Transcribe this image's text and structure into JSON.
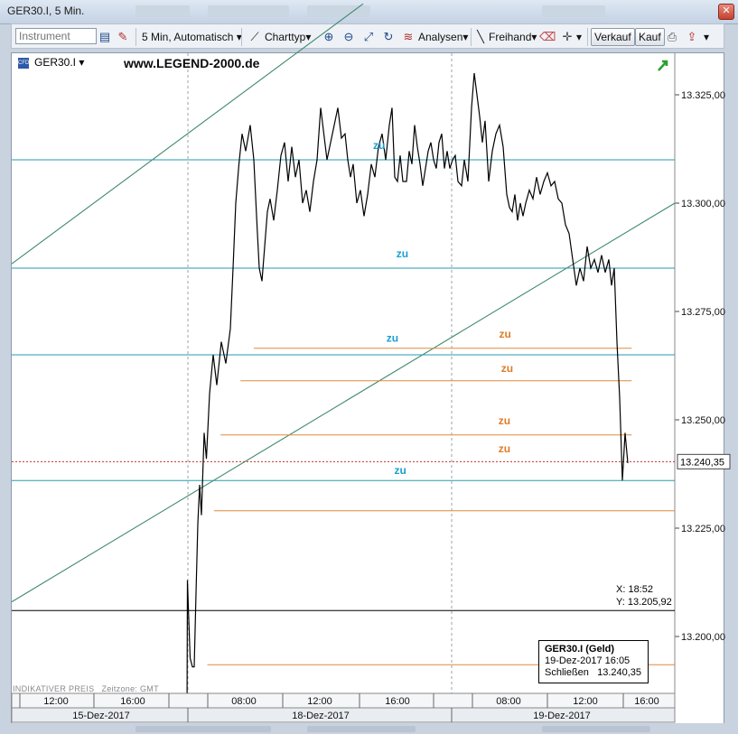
{
  "window": {
    "title": "GER30.I, 5 Min."
  },
  "toolbar": {
    "instrument_placeholder": "Instrument",
    "interval_label": "5 Min,  Automatisch",
    "charttype_label": "Charttyp",
    "analysen_label": "Analysen",
    "freihand_label": "Freihand",
    "verkauf_label": "Verkauf",
    "kauf_label": "Kauf"
  },
  "legend": {
    "symbol": "GER30.I",
    "cfd_badge": "CFD",
    "website": "www.LEGEND-2000.de"
  },
  "crosshair": {
    "x_label": "X: 18:52",
    "y_label": "Y: 13.205,92",
    "y_value": 13205.92
  },
  "infobox": {
    "title": "GER30.I (Geld)",
    "datetime": "19-Dez-2017 16:05",
    "close_label": "Schließen",
    "close_value": "13.240,35"
  },
  "footer": {
    "indicative": "INDIKATIVER PREIS",
    "timezone": "Zeitzone: GMT"
  },
  "colors": {
    "price": "#000000",
    "cyan": "#2a9ab0",
    "orange": "#e08a3a",
    "channel": "#3f8a6a",
    "price_dotted": "#c03030",
    "label_cyan": "#1a9fd0",
    "label_orange": "#e07b28",
    "arrow": "#2aa02a"
  },
  "chart_data": {
    "type": "line",
    "instrument": "GER30.I",
    "interval": "5 Min",
    "y_range": [
      13180,
      13340
    ],
    "y_ticks": [
      {
        "value": 13200,
        "label": "13.200,00"
      },
      {
        "value": 13225,
        "label": "13.225,00"
      },
      {
        "value": 13250,
        "label": "13.250,00"
      },
      {
        "value": 13275,
        "label": "13.275,00"
      },
      {
        "value": 13300,
        "label": "13.300,00"
      },
      {
        "value": 13325,
        "label": "13.325,00"
      }
    ],
    "current_price": {
      "value": 13240.35,
      "label": "13.240,35"
    },
    "x_time_labels": [
      "12:00",
      "16:00",
      "08:00",
      "12:00",
      "16:00",
      "08:00",
      "12:00",
      "16:00"
    ],
    "x_date_labels": [
      "15-Dez-2017",
      "18-Dez-2017",
      "19-Dez-2017"
    ],
    "price_series": [
      {
        "t": 0.0,
        "v": 13181
      },
      {
        "t": 0.1,
        "v": 13213
      },
      {
        "t": 0.35,
        "v": 13205
      },
      {
        "t": 0.7,
        "v": 13195
      },
      {
        "t": 1.2,
        "v": 13193
      },
      {
        "t": 1.6,
        "v": 13193
      },
      {
        "t": 2.0,
        "v": 13210
      },
      {
        "t": 2.4,
        "v": 13226
      },
      {
        "t": 2.8,
        "v": 13235
      },
      {
        "t": 3.2,
        "v": 13228
      },
      {
        "t": 3.8,
        "v": 13247
      },
      {
        "t": 4.3,
        "v": 13241
      },
      {
        "t": 5.0,
        "v": 13256
      },
      {
        "t": 5.8,
        "v": 13265
      },
      {
        "t": 6.6,
        "v": 13258
      },
      {
        "t": 7.6,
        "v": 13268
      },
      {
        "t": 8.6,
        "v": 13263
      },
      {
        "t": 9.6,
        "v": 13271
      },
      {
        "t": 10.2,
        "v": 13285
      },
      {
        "t": 10.8,
        "v": 13300
      },
      {
        "t": 11.5,
        "v": 13309
      },
      {
        "t": 12.2,
        "v": 13316
      },
      {
        "t": 13.0,
        "v": 13312
      },
      {
        "t": 14.0,
        "v": 13318
      },
      {
        "t": 14.8,
        "v": 13310
      },
      {
        "t": 15.5,
        "v": 13295
      },
      {
        "t": 16.0,
        "v": 13285
      },
      {
        "t": 16.6,
        "v": 13282
      },
      {
        "t": 17.2,
        "v": 13290
      },
      {
        "t": 17.8,
        "v": 13298
      },
      {
        "t": 18.4,
        "v": 13301
      },
      {
        "t": 19.2,
        "v": 13296
      },
      {
        "t": 20.0,
        "v": 13303
      },
      {
        "t": 20.8,
        "v": 13311
      },
      {
        "t": 21.6,
        "v": 13314
      },
      {
        "t": 22.4,
        "v": 13305
      },
      {
        "t": 23.2,
        "v": 13313
      },
      {
        "t": 24.0,
        "v": 13306
      },
      {
        "t": 24.8,
        "v": 13310
      },
      {
        "t": 25.6,
        "v": 13300
      },
      {
        "t": 26.4,
        "v": 13303
      },
      {
        "t": 27.2,
        "v": 13298
      },
      {
        "t": 28.0,
        "v": 13305
      },
      {
        "t": 28.8,
        "v": 13310
      },
      {
        "t": 29.6,
        "v": 13322
      },
      {
        "t": 30.3,
        "v": 13316
      },
      {
        "t": 31.0,
        "v": 13310
      },
      {
        "t": 31.8,
        "v": 13314
      },
      {
        "t": 32.6,
        "v": 13318
      },
      {
        "t": 33.4,
        "v": 13322
      },
      {
        "t": 34.2,
        "v": 13315
      },
      {
        "t": 35.0,
        "v": 13316
      },
      {
        "t": 35.6,
        "v": 13310
      },
      {
        "t": 36.2,
        "v": 13306
      },
      {
        "t": 36.8,
        "v": 13309
      },
      {
        "t": 37.6,
        "v": 13300
      },
      {
        "t": 38.4,
        "v": 13303
      },
      {
        "t": 39.2,
        "v": 13297
      },
      {
        "t": 40.0,
        "v": 13302
      },
      {
        "t": 40.8,
        "v": 13309
      },
      {
        "t": 41.6,
        "v": 13306
      },
      {
        "t": 42.4,
        "v": 13313
      },
      {
        "t": 43.2,
        "v": 13316
      },
      {
        "t": 44.0,
        "v": 13310
      },
      {
        "t": 44.8,
        "v": 13318
      },
      {
        "t": 45.4,
        "v": 13322
      },
      {
        "t": 46.0,
        "v": 13306
      },
      {
        "t": 46.6,
        "v": 13305
      },
      {
        "t": 47.2,
        "v": 13311
      },
      {
        "t": 47.8,
        "v": 13305
      },
      {
        "t": 48.6,
        "v": 13305
      },
      {
        "t": 49.2,
        "v": 13312
      },
      {
        "t": 49.8,
        "v": 13309
      },
      {
        "t": 50.4,
        "v": 13318
      },
      {
        "t": 51.0,
        "v": 13313
      },
      {
        "t": 51.6,
        "v": 13309
      },
      {
        "t": 52.2,
        "v": 13304
      },
      {
        "t": 52.8,
        "v": 13308
      },
      {
        "t": 53.4,
        "v": 13312
      },
      {
        "t": 54.0,
        "v": 13314
      },
      {
        "t": 54.6,
        "v": 13310
      },
      {
        "t": 55.2,
        "v": 13308
      },
      {
        "t": 55.8,
        "v": 13314
      },
      {
        "t": 56.4,
        "v": 13316
      },
      {
        "t": 57.0,
        "v": 13308
      },
      {
        "t": 57.6,
        "v": 13312
      },
      {
        "t": 58.2,
        "v": 13308
      },
      {
        "t": 58.8,
        "v": 13310
      },
      {
        "t": 59.4,
        "v": 13311
      },
      {
        "t": 60.0,
        "v": 13305
      },
      {
        "t": 60.8,
        "v": 13304
      },
      {
        "t": 61.4,
        "v": 13310
      },
      {
        "t": 62.2,
        "v": 13305
      },
      {
        "t": 63.0,
        "v": 13322
      },
      {
        "t": 63.6,
        "v": 13330
      },
      {
        "t": 64.2,
        "v": 13325
      },
      {
        "t": 64.8,
        "v": 13320
      },
      {
        "t": 65.4,
        "v": 13314
      },
      {
        "t": 66.0,
        "v": 13319
      },
      {
        "t": 66.8,
        "v": 13305
      },
      {
        "t": 67.6,
        "v": 13312
      },
      {
        "t": 68.4,
        "v": 13316
      },
      {
        "t": 69.2,
        "v": 13318
      },
      {
        "t": 70.0,
        "v": 13313
      },
      {
        "t": 70.8,
        "v": 13302
      },
      {
        "t": 71.4,
        "v": 13299
      },
      {
        "t": 72.0,
        "v": 13298
      },
      {
        "t": 72.6,
        "v": 13302
      },
      {
        "t": 73.2,
        "v": 13296
      },
      {
        "t": 73.8,
        "v": 13300
      },
      {
        "t": 74.4,
        "v": 13297
      },
      {
        "t": 75.0,
        "v": 13300
      },
      {
        "t": 75.8,
        "v": 13303
      },
      {
        "t": 76.6,
        "v": 13301
      },
      {
        "t": 77.4,
        "v": 13306
      },
      {
        "t": 78.2,
        "v": 13302
      },
      {
        "t": 79.0,
        "v": 13305
      },
      {
        "t": 79.8,
        "v": 13307
      },
      {
        "t": 80.6,
        "v": 13304
      },
      {
        "t": 81.4,
        "v": 13305
      },
      {
        "t": 82.2,
        "v": 13301
      },
      {
        "t": 83.0,
        "v": 13300
      },
      {
        "t": 83.8,
        "v": 13295
      },
      {
        "t": 84.6,
        "v": 13293
      },
      {
        "t": 85.4,
        "v": 13287
      },
      {
        "t": 86.2,
        "v": 13281
      },
      {
        "t": 87.0,
        "v": 13285
      },
      {
        "t": 87.8,
        "v": 13282
      },
      {
        "t": 88.6,
        "v": 13290
      },
      {
        "t": 89.4,
        "v": 13285
      },
      {
        "t": 90.2,
        "v": 13287
      },
      {
        "t": 91.0,
        "v": 13284
      },
      {
        "t": 91.8,
        "v": 13288
      },
      {
        "t": 92.6,
        "v": 13284
      },
      {
        "t": 93.4,
        "v": 13287
      },
      {
        "t": 94.0,
        "v": 13281
      },
      {
        "t": 94.6,
        "v": 13285
      },
      {
        "t": 95.2,
        "v": 13268
      },
      {
        "t": 95.8,
        "v": 13255
      },
      {
        "t": 96.4,
        "v": 13236
      },
      {
        "t": 97.0,
        "v": 13247
      },
      {
        "t": 97.6,
        "v": 13240
      }
    ],
    "horizontal_lines": [
      {
        "color": "cyan",
        "value": 13310,
        "from": 0.0,
        "to": 1.0
      },
      {
        "color": "cyan",
        "value": 13285,
        "from": 0.0,
        "to": 1.0
      },
      {
        "color": "cyan",
        "value": 13265,
        "from": 0.0,
        "to": 1.0
      },
      {
        "color": "cyan",
        "value": 13236,
        "from": 0.0,
        "to": 1.0
      },
      {
        "color": "black",
        "value": 13206,
        "from": 0.0,
        "to": 1.0
      },
      {
        "color": "orange",
        "value": 13266.5,
        "from": 0.365,
        "to": 0.935
      },
      {
        "color": "orange",
        "value": 13259,
        "from": 0.345,
        "to": 0.935
      },
      {
        "color": "orange",
        "value": 13246.5,
        "from": 0.315,
        "to": 0.935
      },
      {
        "color": "orange",
        "value": 13229,
        "from": 0.305,
        "to": 1.0
      },
      {
        "color": "orange",
        "value": 13193.5,
        "from": 0.295,
        "to": 1.0
      }
    ],
    "trend_lines": [
      {
        "color": "channel",
        "from": [
          0.0,
          13286
        ],
        "to": [
          0.53,
          13346
        ]
      },
      {
        "color": "channel",
        "from": [
          0.0,
          13208
        ],
        "to": [
          1.0,
          13300
        ]
      }
    ],
    "annotations": [
      {
        "text": "zu",
        "color": "cyan",
        "t": 0.545,
        "v": 13312.5
      },
      {
        "text": "zu",
        "color": "cyan",
        "t": 0.58,
        "v": 13287.5
      },
      {
        "text": "zu",
        "color": "cyan",
        "t": 0.565,
        "v": 13268
      },
      {
        "text": "zu",
        "color": "cyan",
        "t": 0.577,
        "v": 13237.5
      },
      {
        "text": "zu",
        "color": "orange",
        "t": 0.735,
        "v": 13269
      },
      {
        "text": "zu",
        "color": "orange",
        "t": 0.738,
        "v": 13261
      },
      {
        "text": "zu",
        "color": "orange",
        "t": 0.734,
        "v": 13249
      },
      {
        "text": "zu",
        "color": "orange",
        "t": 0.734,
        "v": 13242.5
      }
    ],
    "grid": true,
    "legend_position": "top-left"
  }
}
